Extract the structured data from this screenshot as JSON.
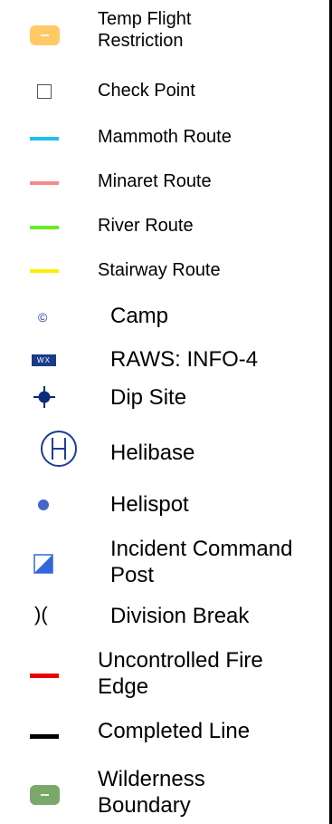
{
  "legend": {
    "items": [
      {
        "label": "Temp Flight Restriction",
        "icon": "temp-flight-restriction-swatch",
        "color": "#ffc966"
      },
      {
        "label": "Check Point",
        "icon": "check-point-square"
      },
      {
        "label": "Mammoth Route",
        "icon": "route-line",
        "color": "#1ec0f0"
      },
      {
        "label": "Minaret Route",
        "icon": "route-line",
        "color": "#f28a8a"
      },
      {
        "label": "River Route",
        "icon": "route-line",
        "color": "#66ee22"
      },
      {
        "label": "Stairway Route",
        "icon": "route-line",
        "color": "#ffee00"
      },
      {
        "label": "Camp",
        "icon": "copyright-symbol-icon",
        "glyph": "©"
      },
      {
        "label": "RAWS: INFO-4",
        "icon": "wx-box-icon",
        "glyph": "WX"
      },
      {
        "label": "Dip Site",
        "icon": "crosshair-circle-icon"
      },
      {
        "label": "Helibase",
        "icon": "circled-h-icon"
      },
      {
        "label": "Helispot",
        "icon": "dot-icon",
        "color": "#4466cc"
      },
      {
        "label": "Incident Command Post",
        "icon": "half-filled-square-icon",
        "color": "#3366dd"
      },
      {
        "label": "Division Break",
        "icon": "parentheses-icon",
        "glyph": ")("
      },
      {
        "label": "Uncontrolled Fire Edge",
        "icon": "fire-edge-line",
        "color": "#ee0000"
      },
      {
        "label": "Completed Line",
        "icon": "completed-line",
        "color": "#000000"
      },
      {
        "label": "Wilderness Boundary",
        "icon": "wilderness-boundary-swatch",
        "color": "#7aa86a"
      }
    ]
  }
}
